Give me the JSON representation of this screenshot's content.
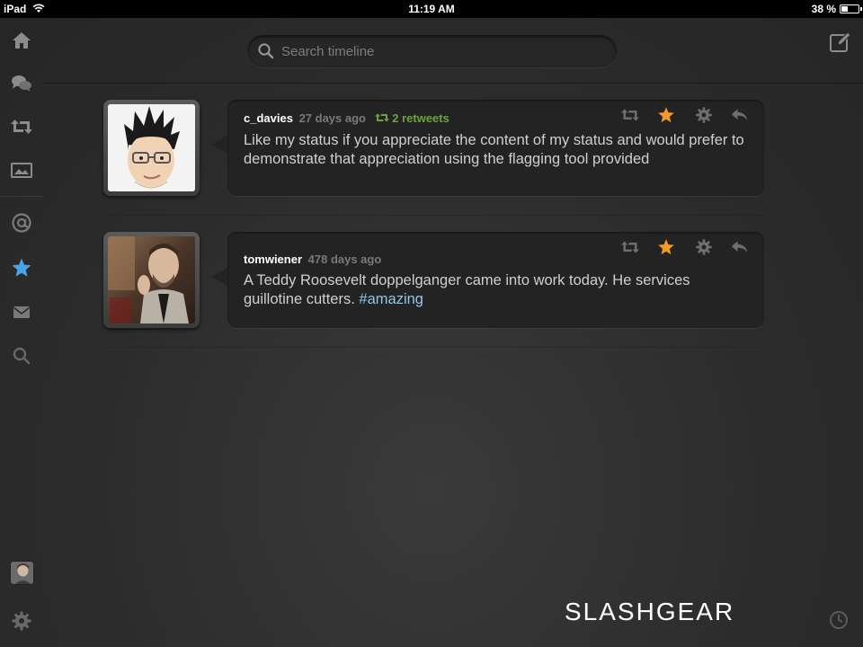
{
  "status_bar": {
    "device": "iPad",
    "time": "11:19 AM",
    "battery": "38 %",
    "battery_level": 0.38
  },
  "sidebar": {
    "items": [
      {
        "name": "home",
        "icon": "home-icon",
        "active": false
      },
      {
        "name": "conversations",
        "icon": "chat-bubbles-icon",
        "active": false
      },
      {
        "name": "retweets",
        "icon": "retweet-icon",
        "active": false
      },
      {
        "name": "media",
        "icon": "photo-icon",
        "active": false
      },
      {
        "name": "mentions",
        "icon": "at-sign-icon",
        "active": false
      },
      {
        "name": "favorites",
        "icon": "star-icon",
        "active": true
      },
      {
        "name": "messages",
        "icon": "envelope-icon",
        "active": false
      },
      {
        "name": "search",
        "icon": "magnifier-icon",
        "active": false
      }
    ],
    "footer": [
      {
        "name": "account",
        "icon": "user-avatar-icon"
      },
      {
        "name": "settings",
        "icon": "gear-icon"
      }
    ]
  },
  "search": {
    "placeholder": "Search timeline",
    "value": ""
  },
  "compose": {
    "icon": "compose-icon"
  },
  "colors": {
    "background": "#2b2b2b",
    "bubble": "#232323",
    "accent_star": "#f5992b",
    "active_nav": "#4aa3e8",
    "retweet_green": "#6aa33f",
    "hashtag": "#8ec7e8"
  },
  "tweets": [
    {
      "username": "c_davies",
      "time": "27 days ago",
      "retweets": "2 retweets",
      "text": "Like my status if you appreciate the content of my status and would prefer to demonstrate that appreciation using the flagging tool provided",
      "hashtag": "",
      "favorited": true
    },
    {
      "username": "tomwiener",
      "time": "478 days ago",
      "retweets": "",
      "text": "A Teddy Roosevelt doppelganger came into work today. He services guillotine cutters.",
      "hashtag": "#amazing",
      "favorited": true
    }
  ],
  "watermark": "SLASHGEAR"
}
